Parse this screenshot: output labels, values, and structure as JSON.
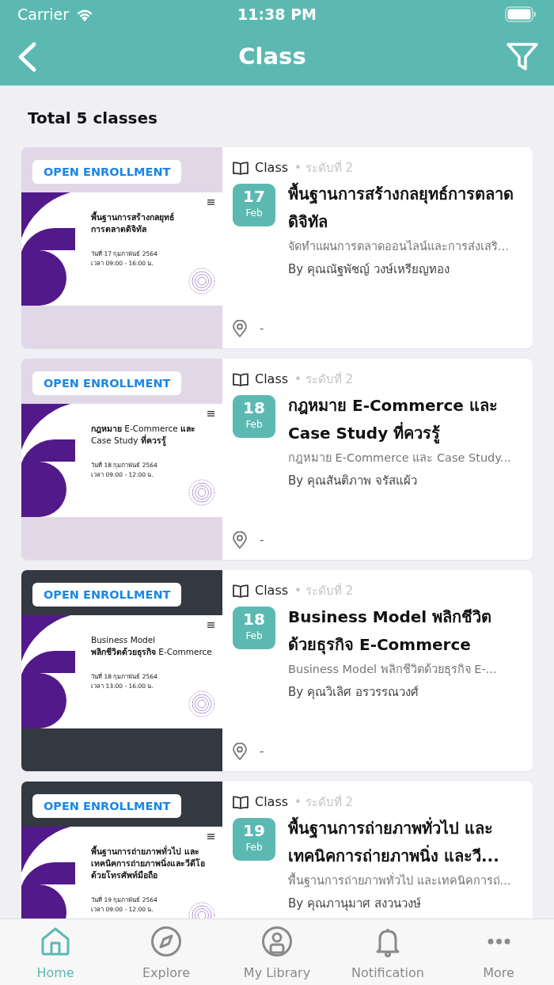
{
  "status_bar": {
    "carrier": "Carrier",
    "time": "11:38 PM"
  },
  "nav_bar": {
    "title": "Class"
  },
  "summary": "Total 5 classes",
  "classes": [
    {
      "badge": "OPEN ENROLLMENT",
      "kind": "light",
      "banner": {
        "title_lines": [
          "**พื้นฐานการสร้างกลยุทธ์**",
          "**การตลาดดิจิทัล**"
        ],
        "date": "วันที่ 17 กุมภาพันธ์ 2564",
        "time": "เวลา 09:00 - 16:00 น."
      },
      "type": "Class",
      "level": "• ระดับที่ 2",
      "day": "17",
      "month": "Feb",
      "title": "พื้นฐานการสร้างกลยุทธ์การตลาดดิจิทัล",
      "subtitle": "จัดทำแผนการตลาดออนไลน์และการส่งเสริ...",
      "instructor": "By คุณณัฐพัชญ์ วงษ์เหรียญทอง",
      "location": "-"
    },
    {
      "badge": "OPEN ENROLLMENT",
      "kind": "light",
      "banner": {
        "title_lines": [
          "**กฎหมาย** E-Commerce **และ**",
          "Case Study **ที่ควรรู้**"
        ],
        "date": "วันที่ 18 กุมภาพันธ์ 2564",
        "time": "เวลา 09:00 - 12:00 น."
      },
      "type": "Class",
      "level": "• ระดับที่ 2",
      "day": "18",
      "month": "Feb",
      "title": "กฎหมาย E-Commerce และ Case Study ที่ควรรู้",
      "subtitle": "กฎหมาย E-Commerce และ Case Study...",
      "instructor": "By คุณสันติภาพ จรัสแผ้ว",
      "location": "-"
    },
    {
      "badge": "OPEN ENROLLMENT",
      "kind": "dark",
      "banner": {
        "title_lines": [
          "Business Model",
          "**พลิกชีวิตด้วยธุรกิจ** E-Commerce"
        ],
        "date": "วันที่ 18 กุมภาพันธ์ 2564",
        "time": "เวลา 13:00 - 16:00 น."
      },
      "type": "Class",
      "level": "• ระดับที่ 2",
      "day": "18",
      "month": "Feb",
      "title": "Business Model พลิกชีวิต ด้วยธุรกิจ E-Commerce",
      "subtitle": "Business Model พลิกชีวิตด้วยธุรกิจ E-...",
      "instructor": "By คุณวิเลิศ อรวรรณวงศ์",
      "location": "-"
    },
    {
      "badge": "OPEN ENROLLMENT",
      "kind": "dark",
      "banner": {
        "title_lines": [
          "**พื้นฐานการถ่ายภาพทั่วไป และ**",
          "**เทคนิคการถ่ายภาพนิ่งและวีดีโอ**",
          "**ด้วยโทรศัพท์มือถือ**"
        ],
        "date": "วันที่ 19 กุมภาพันธ์ 2564",
        "time": "เวลา 09:00 - 12:00 น."
      },
      "type": "Class",
      "level": "• ระดับที่ 2",
      "day": "19",
      "month": "Feb",
      "title": "พื้นฐานการถ่ายภาพทั่วไป และเทคนิคการถ่ายภาพนิ่ง และวี...",
      "subtitle": "พื้นฐานการถ่ายภาพทั่วไป และเทคนิคการถ่...",
      "instructor": "By คุณภานุมาศ สงวนวงษ์"
    }
  ],
  "tab_bar": [
    {
      "label": "Home",
      "selected": true
    },
    {
      "label": "Explore",
      "selected": false
    },
    {
      "label": "My Library",
      "selected": false
    },
    {
      "label": "Notification",
      "selected": false
    },
    {
      "label": "More",
      "selected": false
    }
  ]
}
